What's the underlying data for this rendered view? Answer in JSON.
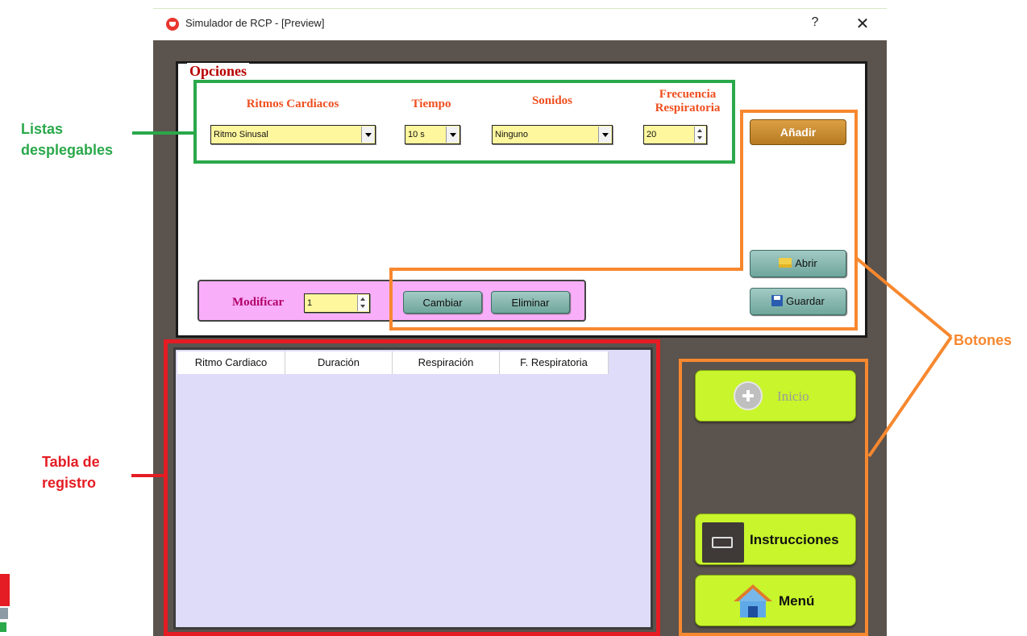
{
  "window": {
    "title": "Simulador de RCP - [Preview]",
    "help_glyph": "?",
    "close_glyph": "✕"
  },
  "options": {
    "legend": "Opciones",
    "columns": {
      "rhythm": "Ritmos Cardiacos",
      "time": "Tiempo",
      "sounds": "Sonidos",
      "resp_freq_line1": "Frecuencia",
      "resp_freq_line2": "Respiratoria"
    },
    "rhythm_value": "Ritmo Sinusal",
    "time_value": "10 s",
    "sounds_value": "Ninguno",
    "resp_freq_value": "20",
    "add_label": "Añadir",
    "open_label": "Abrir",
    "save_label": "Guardar",
    "modify_label": "Modificar",
    "modify_value": "1",
    "change_label": "Cambiar",
    "delete_label": "Eliminar"
  },
  "table": {
    "headers": [
      "Ritmo Cardiaco",
      "Duración",
      "Respiración",
      "F. Respiratoria"
    ]
  },
  "side_buttons": {
    "start_label": "Inicio",
    "instructions_label": "Instrucciones",
    "menu_label": "Menú"
  },
  "annotations": {
    "listas_line1": "Listas",
    "listas_line2": "desplegables",
    "botones": "Botones",
    "tabla_line1": "Tabla de",
    "tabla_line2": "registro"
  },
  "colors": {
    "green_annotation": "#2aa84a",
    "red_annotation": "#e51c23",
    "orange_annotation": "#f7882f",
    "window_body": "#5b534d",
    "dropdown_fill": "#fff79e",
    "green_button": "#c8f52c"
  }
}
